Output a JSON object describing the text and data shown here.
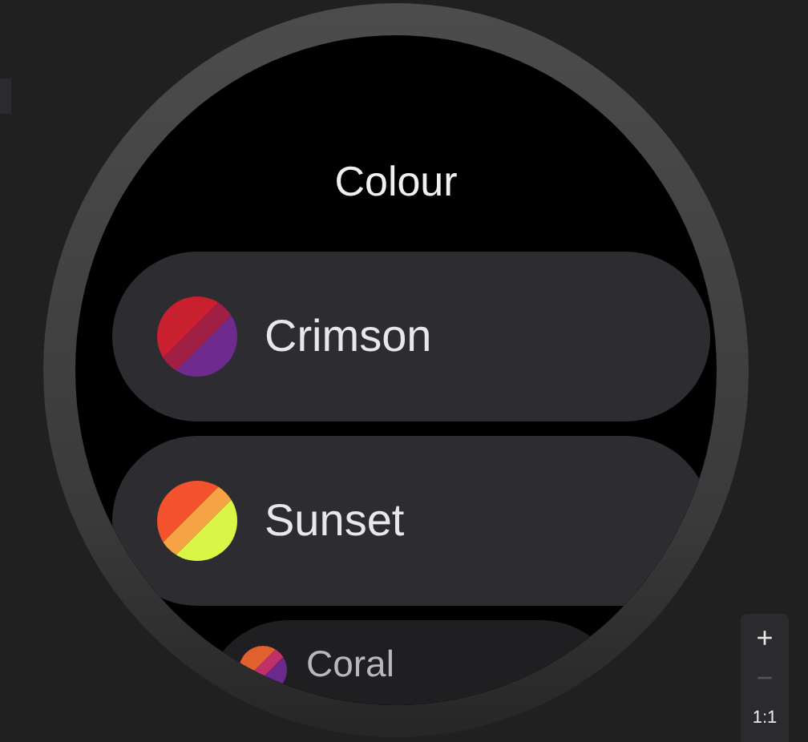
{
  "screen": {
    "title": "Colour",
    "items": [
      {
        "label": "Crimson",
        "stripes": [
          {
            "color": "#c8202e"
          },
          {
            "color": "#a01f45"
          },
          {
            "color": "#6e2a8c"
          }
        ]
      },
      {
        "label": "Sunset",
        "stripes": [
          {
            "color": "#f4522d"
          },
          {
            "color": "#f5a344"
          },
          {
            "color": "#d9f545"
          }
        ]
      },
      {
        "label": "Coral",
        "stripes": [
          {
            "color": "#e0602e"
          },
          {
            "color": "#c0306a"
          },
          {
            "color": "#6a2a8c"
          }
        ]
      }
    ]
  },
  "zoom_controls": [
    {
      "label": "+",
      "disabled": false
    },
    {
      "label": "−",
      "disabled": true
    },
    {
      "label": "1:1",
      "disabled": false
    }
  ]
}
